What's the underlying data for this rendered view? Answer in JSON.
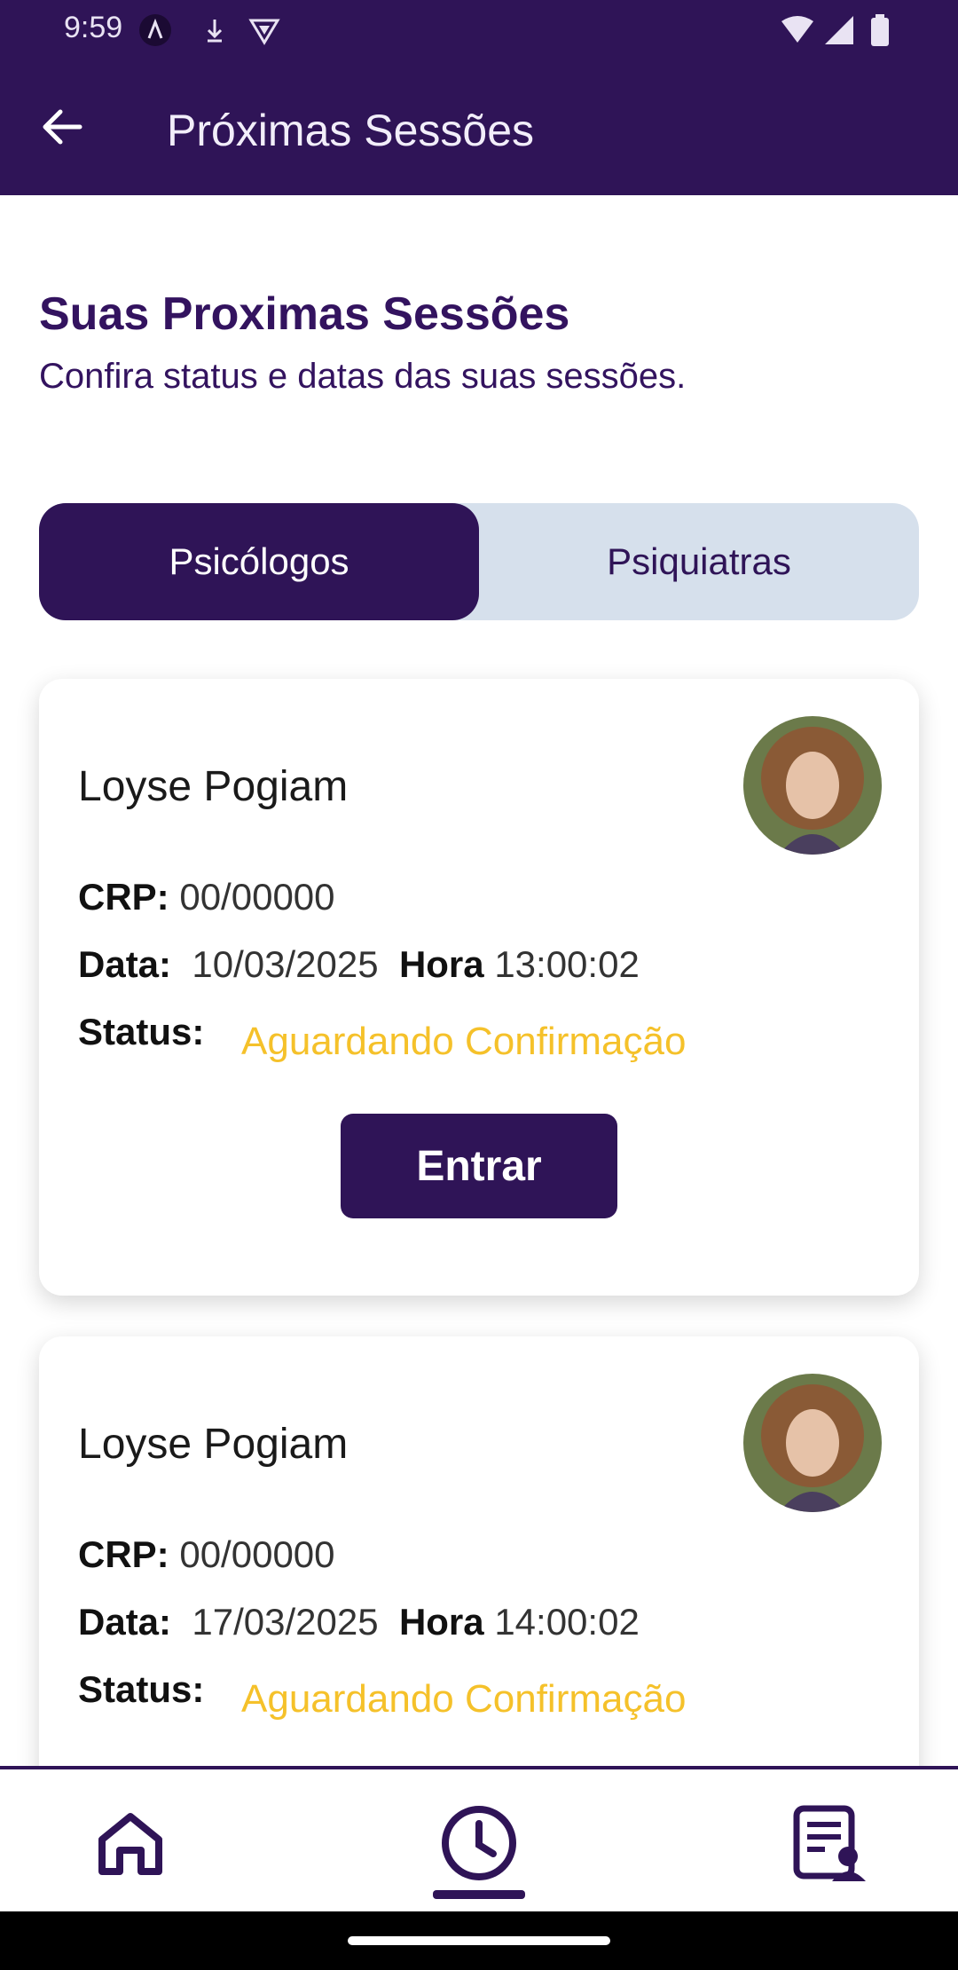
{
  "status_bar": {
    "time": "9:59"
  },
  "app_bar": {
    "title": "Próximas Sessões"
  },
  "page": {
    "heading": "Suas Proximas Sessões",
    "subheading": "Confira status e datas das suas sessões."
  },
  "tabs": [
    {
      "label": "Psicólogos",
      "active": true
    },
    {
      "label": "Psiquiatras",
      "active": false
    }
  ],
  "sessions": [
    {
      "name": "Loyse Pogiam",
      "crp_label": "CRP:",
      "crp": "00/00000",
      "date_label": "Data:",
      "date": "10/03/2025",
      "time_label": "Hora",
      "time": "13:00:02",
      "status_label": "Status:",
      "status": "Aguardando Confirmação",
      "button_label": "Entrar"
    },
    {
      "name": "Loyse Pogiam",
      "crp_label": "CRP:",
      "crp": "00/00000",
      "date_label": "Data:",
      "date": "17/03/2025",
      "time_label": "Hora",
      "time": "14:00:02",
      "status_label": "Status:",
      "status": "Aguardando Confirmação"
    }
  ],
  "colors": {
    "primary": "#2f1457",
    "status_pending": "#f5c12a",
    "tab_inactive_bg": "#d6e0ec"
  },
  "bottom_nav": [
    {
      "icon": "home-icon",
      "active": false
    },
    {
      "icon": "clock-icon",
      "active": true
    },
    {
      "icon": "records-icon",
      "active": false
    }
  ]
}
